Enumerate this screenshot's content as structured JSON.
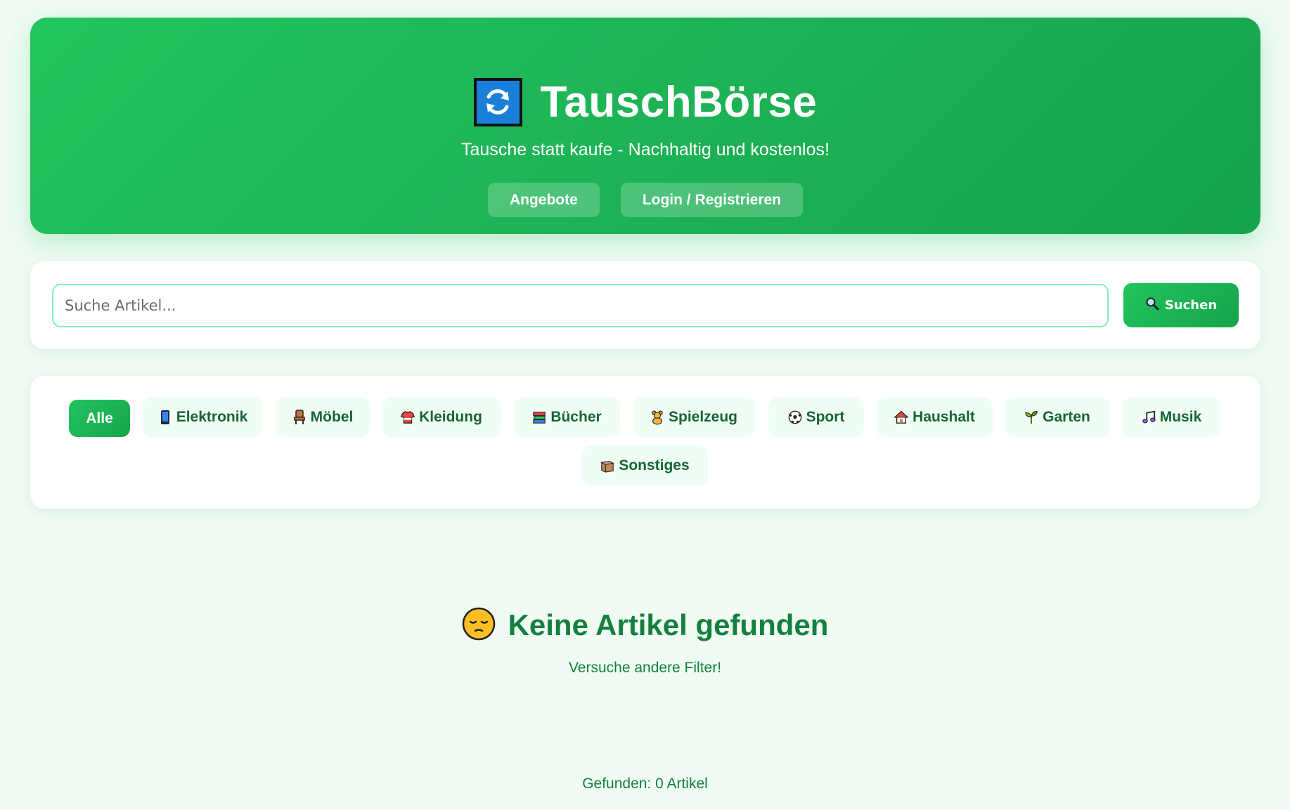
{
  "header": {
    "title": "TauschBörse",
    "logo_icon": "swap-arrows-icon",
    "subtitle": "Tausche statt kaufe - Nachhaltig und kostenlos!",
    "nav": {
      "offers": "Angebote",
      "login": "Login / Registrieren"
    }
  },
  "search": {
    "placeholder": "Suche Artikel...",
    "value": "",
    "button_label": "Suchen",
    "button_icon": "magnifier-icon"
  },
  "categories": [
    {
      "label": "Alle",
      "icon": "",
      "active": true
    },
    {
      "label": "Elektronik",
      "icon": "phone-icon",
      "active": false
    },
    {
      "label": "Möbel",
      "icon": "chair-icon",
      "active": false
    },
    {
      "label": "Kleidung",
      "icon": "shirt-icon",
      "active": false
    },
    {
      "label": "Bücher",
      "icon": "books-icon",
      "active": false
    },
    {
      "label": "Spielzeug",
      "icon": "teddy-bear-icon",
      "active": false
    },
    {
      "label": "Sport",
      "icon": "soccer-ball-icon",
      "active": false
    },
    {
      "label": "Haushalt",
      "icon": "house-icon",
      "active": false
    },
    {
      "label": "Garten",
      "icon": "seedling-icon",
      "active": false
    },
    {
      "label": "Musik",
      "icon": "music-note-icon",
      "active": false
    },
    {
      "label": "Sonstiges",
      "icon": "package-icon",
      "active": false
    }
  ],
  "empty_state": {
    "icon": "pensive-face-icon",
    "title": "Keine Artikel gefunden",
    "subtitle": "Versuche andere Filter!"
  },
  "result_count": "Gefunden: 0 Artikel",
  "colors": {
    "brand_green": "#22c55e",
    "brand_green_dark": "#16a34a",
    "text_green": "#15803d",
    "chip_bg": "#f0fdf4",
    "page_bg": "#effbf3"
  }
}
